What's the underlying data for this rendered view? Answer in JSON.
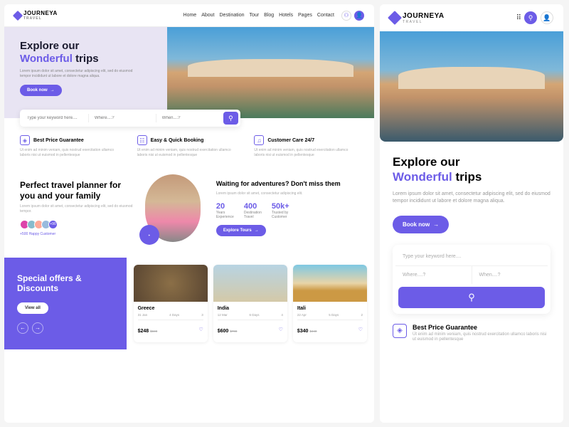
{
  "brand": {
    "name": "JOURNEYA",
    "sub": "TRAVEL"
  },
  "nav": [
    "Home",
    "About",
    "Destination",
    "Tour",
    "Blog",
    "Hotels",
    "Pages",
    "Contact"
  ],
  "hero": {
    "line1": "Explore our",
    "accent": "Wonderful",
    "line2": "trips",
    "sub": "Lorem ipsum dolor sit amet, consectetur adipiscing elit, sed do eiusmod tempor incididunt ut labore et dolore magna aliqua.",
    "cta": "Book now"
  },
  "search": {
    "kw": "Type your keyword here....",
    "where": "Where....?",
    "when": "When....?"
  },
  "features": [
    {
      "icon": "◈",
      "title": "Best Price Guarantee",
      "desc": "Ut enim ad minim veniam, quis nostrud exercitation ullamco laboris nisi ut euismod in pellentesque"
    },
    {
      "icon": "☷",
      "title": "Easy & Quick Booking",
      "desc": "Ut enim ad minim veniam, quis nostrud exercitation ullamco laboris nisi ut euismod in pellentesque"
    },
    {
      "icon": "♫",
      "title": "Customer Care 24/7",
      "desc": "Ut enim ad minim veniam, quis nostrud exercitation ullamco laboris nisi ut euismod in pellentesque"
    }
  ],
  "planner": {
    "title": "Perfect travel planner for you and your family",
    "desc": "Lorem ipsum dolor sit amet, consectetur adipiscing elit, sed do eiusmod tempor.",
    "more": "+90",
    "happy": "+500 Happy Customer",
    "rightTitle": "Waiting for adventures? Don't miss them",
    "rightDesc": "Lorem ipsum dolor sit amet, consectetur adipiscing elit.",
    "stats": [
      {
        "n": "20",
        "l1": "Years",
        "l2": "Experience"
      },
      {
        "n": "400",
        "l1": "Destination",
        "l2": "Travel"
      },
      {
        "n": "50k+",
        "l1": "Trusted by",
        "l2": "Customer"
      }
    ],
    "cta": "Explore Tours"
  },
  "offers": {
    "title": "Special offers & Discounts",
    "cta": "View all"
  },
  "cards": [
    {
      "name": "Greece",
      "date": "31 Jan",
      "days": "4 Days",
      "ppl": "3",
      "price": "$248",
      "old": "$348"
    },
    {
      "name": "India",
      "date": "12 Mar",
      "days": "6 Days",
      "ppl": "4",
      "price": "$600",
      "old": "$700"
    },
    {
      "name": "Itali",
      "date": "22 Apr",
      "days": "5 Days",
      "ppl": "2",
      "price": "$340",
      "old": "$440"
    }
  ],
  "mobile": {
    "sub": "Lorem ipsum dolor sit amet, consectetur adipiscing elit, sed do eiusmod tempor incididunt ut labore et dolore magna aliqua."
  }
}
